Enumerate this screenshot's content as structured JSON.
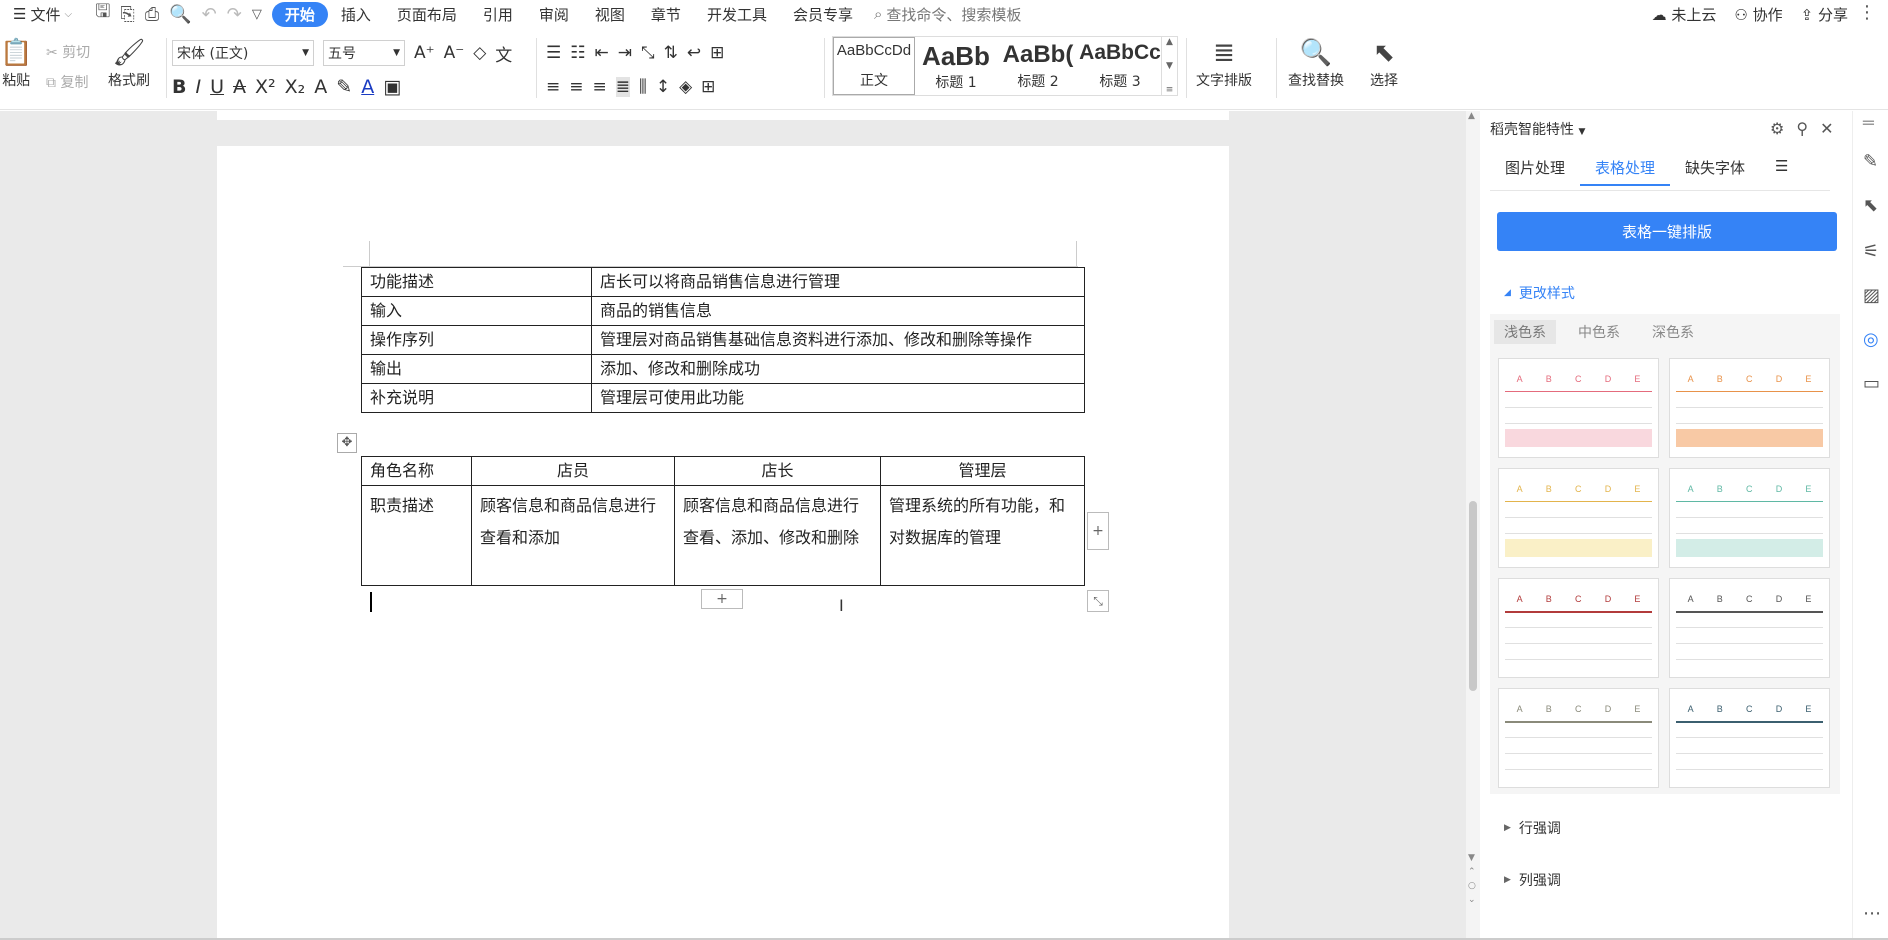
{
  "menubar": {
    "file_label": "文件",
    "items": [
      "开始",
      "插入",
      "页面布局",
      "引用",
      "审阅",
      "视图",
      "章节",
      "开发工具",
      "会员专享"
    ],
    "active_index": 0,
    "search_placeholder": "查找命令、搜索模板",
    "cloud_label": "未上云",
    "collab_label": "协作",
    "share_label": "分享"
  },
  "ribbon": {
    "paste_label": "粘贴",
    "cut_label": "剪切",
    "copy_label": "复制",
    "format_painter_label": "格式刷",
    "font_name": "宋体 (正文)",
    "font_size": "五号",
    "styles": [
      {
        "preview": "AaBbCcDd",
        "name": "正文"
      },
      {
        "preview": "AaBb",
        "name": "标题 1"
      },
      {
        "preview": "AaBb(",
        "name": "标题 2"
      },
      {
        "preview": "AaBbCc",
        "name": "标题 3"
      }
    ],
    "text_layout_label": "文字排版",
    "find_replace_label": "查找替换",
    "select_label": "选择"
  },
  "document": {
    "table1": [
      [
        "功能描述",
        "店长可以将商品销售信息进行管理"
      ],
      [
        "输入",
        "商品的销售信息"
      ],
      [
        "操作序列",
        "管理层对商品销售基础信息资料进行添加、修改和删除等操作"
      ],
      [
        "输出",
        "添加、修改和删除成功"
      ],
      [
        "补充说明",
        "管理层可使用此功能"
      ]
    ],
    "table2": {
      "headers": [
        "角色名称",
        "店员",
        "店长",
        "管理层"
      ],
      "row": [
        "职责描述",
        "顾客信息和商品信息进行查看和添加",
        "顾客信息和商品信息进行查看、添加、修改和删除",
        "管理系统的所有功能，和对数据库的管理"
      ]
    }
  },
  "pane": {
    "title": "稻壳智能特性",
    "tabs": [
      "图片处理",
      "表格处理",
      "缺失字体"
    ],
    "active_tab": 1,
    "oneclick_label": "表格一键排版",
    "change_style_label": "更改样式",
    "schemes": [
      "浅色系",
      "中色系",
      "深色系"
    ],
    "row_emphasis_label": "行强调",
    "col_emphasis_label": "列强调",
    "thumb_letters": [
      "A",
      "B",
      "C",
      "D",
      "E"
    ],
    "thumb_colors": [
      "#e46b7c",
      "#e8924a",
      "#e3b44c",
      "#5fb8a4",
      "#b23b3b",
      "#555555",
      "#8a8a7a",
      "#3b5f6f"
    ],
    "thumb_bands": [
      "#f9d8de",
      "#f8c9a5",
      "#faf0c7",
      "#d3ede7",
      "",
      "",
      "",
      ""
    ]
  }
}
